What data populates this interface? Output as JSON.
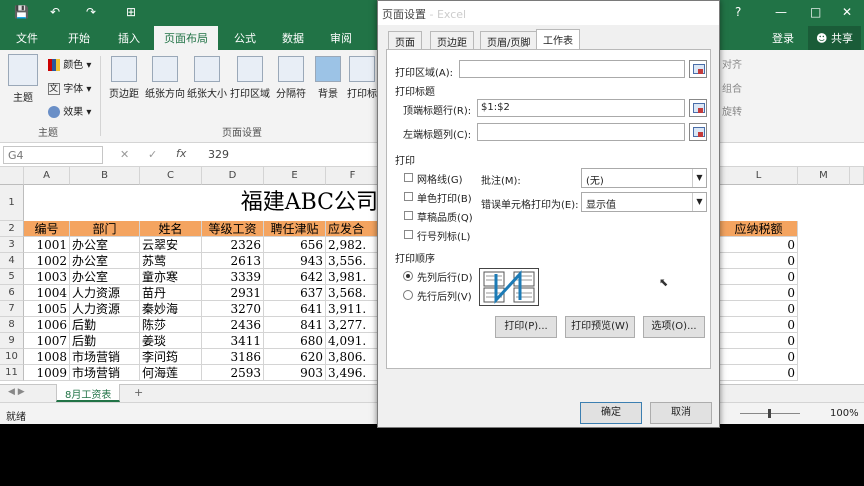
{
  "titlebar": {
    "quick": [
      "💾",
      "↶",
      "↷",
      "⊞"
    ],
    "controls": [
      "?",
      "—",
      "□",
      "✕"
    ]
  },
  "ribbon": {
    "tabs": [
      "文件",
      "开始",
      "插入",
      "页面布局",
      "公式",
      "数据",
      "审阅"
    ],
    "login": "登录",
    "share": "共享",
    "theme_group": {
      "themes": "主题",
      "colors": "颜色",
      "fonts": "字体",
      "effects": "效果",
      "label": "主题"
    },
    "pagesetup_group": {
      "margins": "页边距",
      "orientation": "纸张方向",
      "size": "纸张大小",
      "print_area": "打印区域",
      "breaks": "分隔符",
      "background": "背景",
      "titles": "打印标",
      "label": "页面设置"
    },
    "right_group": {
      "align": "对齐",
      "group": "组合",
      "rotate": "旋转"
    }
  },
  "formula_bar": {
    "cell": "G4",
    "cancel": "✕",
    "enter": "✓",
    "fx": "fx",
    "value": "329"
  },
  "sheet": {
    "columns": [
      "A",
      "B",
      "C",
      "D",
      "E",
      "F",
      "L",
      "M"
    ],
    "title": "福建ABC公司",
    "headers": [
      "编号",
      "部门",
      "姓名",
      "等级工资",
      "聘任津贴",
      "应发合",
      "应纳税额"
    ],
    "rows": [
      [
        "1001",
        "办公室",
        "云翠安",
        "2326",
        "656",
        "2,982.",
        "0"
      ],
      [
        "1002",
        "办公室",
        "苏莺",
        "2613",
        "943",
        "3,556.",
        "0"
      ],
      [
        "1003",
        "办公室",
        "童亦寒",
        "3339",
        "642",
        "3,981.",
        "0"
      ],
      [
        "1004",
        "人力资源",
        "苗丹",
        "2931",
        "637",
        "3,568.",
        "0"
      ],
      [
        "1005",
        "人力资源",
        "秦妙海",
        "3270",
        "641",
        "3,911.",
        "0"
      ],
      [
        "1006",
        "后勤",
        "陈莎",
        "2436",
        "841",
        "3,277.",
        "0"
      ],
      [
        "1007",
        "后勤",
        "姜琰",
        "3411",
        "680",
        "4,091.",
        "0"
      ],
      [
        "1008",
        "市场营销",
        "李问筠",
        "3186",
        "620",
        "3,806.",
        "0"
      ],
      [
        "1009",
        "市场营销",
        "何海莲",
        "2593",
        "903",
        "3,496.",
        "0"
      ]
    ],
    "row_numbers": [
      "1",
      "2",
      "3",
      "4",
      "5",
      "6",
      "7",
      "8",
      "9",
      "10",
      "11"
    ],
    "tab": "8月工资表",
    "add": "+"
  },
  "status": {
    "ready": "就绪",
    "zoom": "100%"
  },
  "dialog": {
    "title": "页面设置",
    "title_suffix": " - Excel",
    "tabs": [
      "页面",
      "页边距",
      "页眉/页脚",
      "工作表"
    ],
    "print_area_label": "打印区域(A):",
    "print_area_value": "",
    "print_titles": "打印标题",
    "top_rows_label": "顶端标题行(R):",
    "top_rows_value": "$1:$2",
    "left_cols_label": "左端标题列(C):",
    "left_cols_value": "",
    "print_section": "打印",
    "gridlines": "网格线(G)",
    "mono": "单色打印(B)",
    "draft": "草稿品质(Q)",
    "rowcol": "行号列标(L)",
    "comments_label": "批注(M):",
    "comments_value": "(无)",
    "errors_label": "错误单元格打印为(E):",
    "errors_value": "显示值",
    "order_section": "打印顺序",
    "down_then_over": "先列后行(D)",
    "over_then_down": "先行后列(V)",
    "print_btn": "打印(P)...",
    "preview_btn": "打印预览(W)",
    "options_btn": "选项(O)...",
    "ok": "确定",
    "cancel": "取消"
  }
}
